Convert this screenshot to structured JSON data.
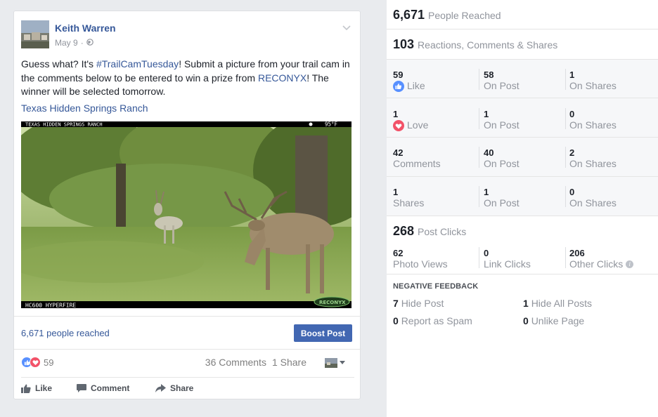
{
  "post": {
    "author": "Keith Warren",
    "date": "May 9",
    "date_sep": "·",
    "text_before": "Guess what? It's ",
    "hashtag": "#TrailCamTuesday",
    "text_middle": "! Submit a picture from your trail cam in the comments below to be entered to win a prize from ",
    "brand_link": "RECONYX",
    "text_after": "! The winner will be selected tomorrow.",
    "place": "Texas Hidden Springs Ranch",
    "photo": {
      "top_left_banner": "TEXAS HIDDEN SPRINGS RANCH",
      "temperature": "95°F",
      "bottom_left": "HC600 HYPERFIRE",
      "bottom_right": "RECONYX"
    },
    "reached": "6,671 people reached",
    "boost_label": "Boost Post",
    "reaction_count": "59",
    "comments": "36 Comments",
    "shares": "1 Share",
    "actions": {
      "like": "Like",
      "comment": "Comment",
      "share": "Share"
    }
  },
  "insights": {
    "people_reached": {
      "value": "6,671",
      "label": "People Reached"
    },
    "reactions_total": {
      "value": "103",
      "label": "Reactions, Comments & Shares"
    },
    "rows": [
      {
        "cells": [
          {
            "n": "59",
            "l": "Like",
            "icon": "like-icon"
          },
          {
            "n": "58",
            "l": "On Post"
          },
          {
            "n": "1",
            "l": "On Shares"
          }
        ]
      },
      {
        "cells": [
          {
            "n": "1",
            "l": "Love",
            "icon": "love-icon"
          },
          {
            "n": "1",
            "l": "On Post"
          },
          {
            "n": "0",
            "l": "On Shares"
          }
        ]
      },
      {
        "cells": [
          {
            "n": "42",
            "l": "Comments"
          },
          {
            "n": "40",
            "l": "On Post"
          },
          {
            "n": "2",
            "l": "On Shares"
          }
        ]
      },
      {
        "cells": [
          {
            "n": "1",
            "l": "Shares"
          },
          {
            "n": "1",
            "l": "On Post"
          },
          {
            "n": "0",
            "l": "On Shares"
          }
        ]
      }
    ],
    "post_clicks": {
      "value": "268",
      "label": "Post Clicks"
    },
    "clicks": [
      {
        "n": "62",
        "l": "Photo Views"
      },
      {
        "n": "0",
        "l": "Link Clicks"
      },
      {
        "n": "206",
        "l": "Other Clicks"
      }
    ],
    "negative_title": "NEGATIVE FEEDBACK",
    "negative": [
      {
        "n": "7",
        "l": "Hide Post"
      },
      {
        "n": "1",
        "l": "Hide All Posts"
      },
      {
        "n": "0",
        "l": "Report as Spam"
      },
      {
        "n": "0",
        "l": "Unlike Page"
      }
    ],
    "colors": {
      "accent": "#4267b2",
      "link": "#365899",
      "muted": "#90949c",
      "like_blue": "#5890ff",
      "love_red": "#f25268"
    }
  }
}
